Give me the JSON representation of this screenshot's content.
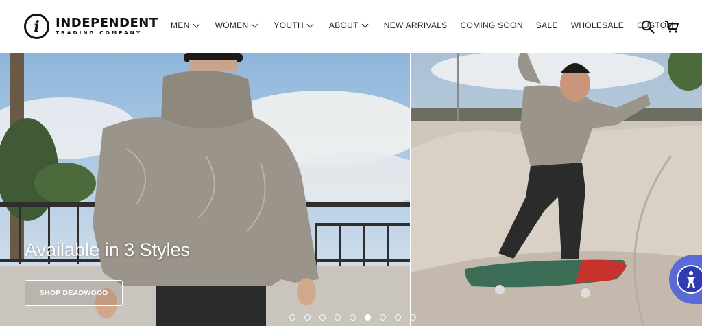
{
  "brand": {
    "logo_letter": "i",
    "name": "INDEPENDENT",
    "tagline": "TRADING COMPANY"
  },
  "nav": {
    "items": [
      {
        "label": "MEN",
        "dropdown": true
      },
      {
        "label": "WOMEN",
        "dropdown": true
      },
      {
        "label": "YOUTH",
        "dropdown": true
      },
      {
        "label": "ABOUT",
        "dropdown": true
      },
      {
        "label": "NEW ARRIVALS",
        "dropdown": false
      },
      {
        "label": "COMING SOON",
        "dropdown": false
      },
      {
        "label": "SALE",
        "dropdown": false
      },
      {
        "label": "WHOLESALE",
        "dropdown": false
      },
      {
        "label": "CUSTOM",
        "dropdown": false
      }
    ]
  },
  "icons": {
    "search": "search-icon",
    "cart": "cart-icon",
    "accessibility": "accessibility-icon"
  },
  "hero": {
    "title": "Available in 3 Styles",
    "button_label": "SHOP DEADWOOD",
    "slide_count": 9,
    "active_slide": 6
  },
  "colors": {
    "accent_a11y": "#5b6bd6"
  }
}
